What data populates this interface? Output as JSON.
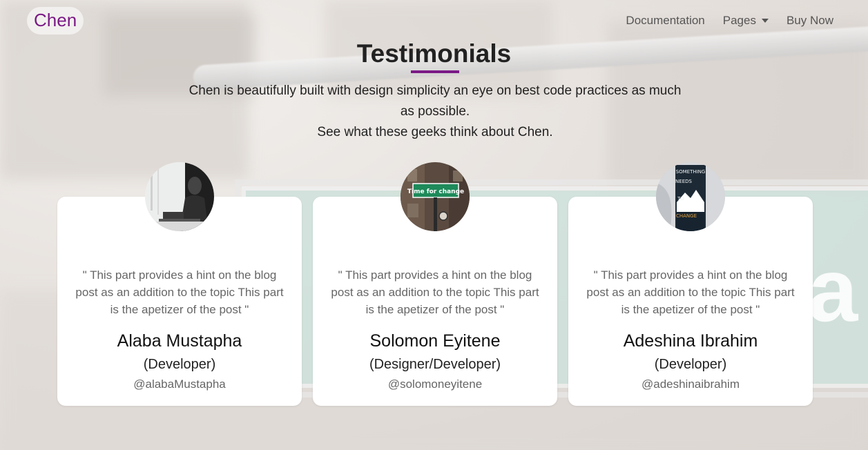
{
  "brand": {
    "name": "Chen"
  },
  "nav": {
    "documentation": "Documentation",
    "pages": "Pages",
    "buy_now": "Buy Now"
  },
  "section": {
    "title": "Testimonials",
    "subtitle_line1": "Chen is beautifully built with design simplicity an eye on best code practices as much as possible.",
    "subtitle_line2": "See what these geeks think about Chen."
  },
  "testimonials": [
    {
      "quote": "\" This part provides a hint on the blog post as an addition to the topic This part is the apetizer of the post \"",
      "name": "Alaba Mustapha",
      "role": "(Developer)",
      "handle": "@alabaMustapha"
    },
    {
      "quote": "\" This part provides a hint on the blog post as an addition to the topic This part is the apetizer of the post \"",
      "name": "Solomon Eyitene",
      "role": "(Designer/Developer)",
      "handle": "@solomoneyitene"
    },
    {
      "quote": "\" This part provides a hint on the blog post as an addition to the topic This part is the apetizer of the post \"",
      "name": "Adeshina Ibrahim",
      "role": "(Developer)",
      "handle": "@adeshinaibrahim"
    }
  ],
  "photo_text": {
    "sign": "Time for change",
    "book_lines": [
      "SOMETHING",
      "NEEDS",
      "TO",
      "CHANGE"
    ]
  },
  "colors": {
    "accent": "#7b1a86",
    "card": "#ffffff",
    "text": "#222222",
    "muted": "#666666"
  }
}
